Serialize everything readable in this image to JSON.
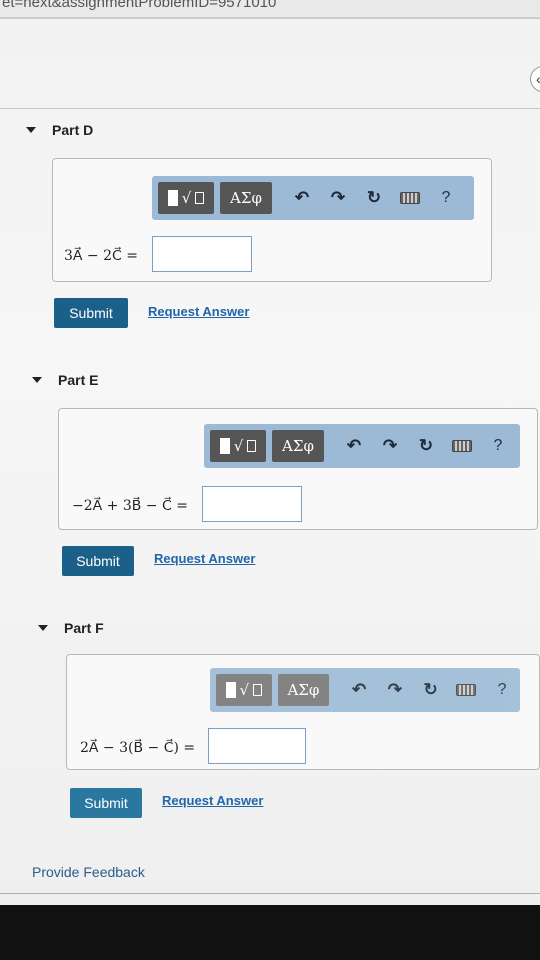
{
  "url_fragment": "et=next&assignmentProblemID=9571010",
  "nav": {
    "back_icon": "chevron-left-icon",
    "back_glyph": "‹"
  },
  "toolbar": {
    "template_glyph": "√",
    "greek_label": "ΑΣφ",
    "undo_glyph": "↶",
    "redo_glyph": "↷",
    "reset_glyph": "↻",
    "help_label": "?",
    "icons": [
      "template-icon",
      "greek-icon",
      "undo-icon",
      "redo-icon",
      "reset-icon",
      "keyboard-icon",
      "help-icon"
    ]
  },
  "parts": [
    {
      "title": "Part D",
      "expression": "3A⃗ − 2C⃗ =",
      "answer": "",
      "submit_label": "Submit",
      "request_label": "Request Answer"
    },
    {
      "title": "Part E",
      "expression": "−2A⃗ + 3B⃗ − C⃗ =",
      "answer": "",
      "submit_label": "Submit",
      "request_label": "Request Answer"
    },
    {
      "title": "Part F",
      "expression": "2A⃗ − 3(B⃗ − C⃗) =",
      "answer": "",
      "submit_label": "Submit",
      "request_label": "Request Answer"
    }
  ],
  "footer": {
    "feedback_label": "Provide Feedback"
  },
  "colors": {
    "submit_bg": "#1a6088",
    "toolbar_bg": "#9cbad6",
    "link": "#2266aa"
  }
}
